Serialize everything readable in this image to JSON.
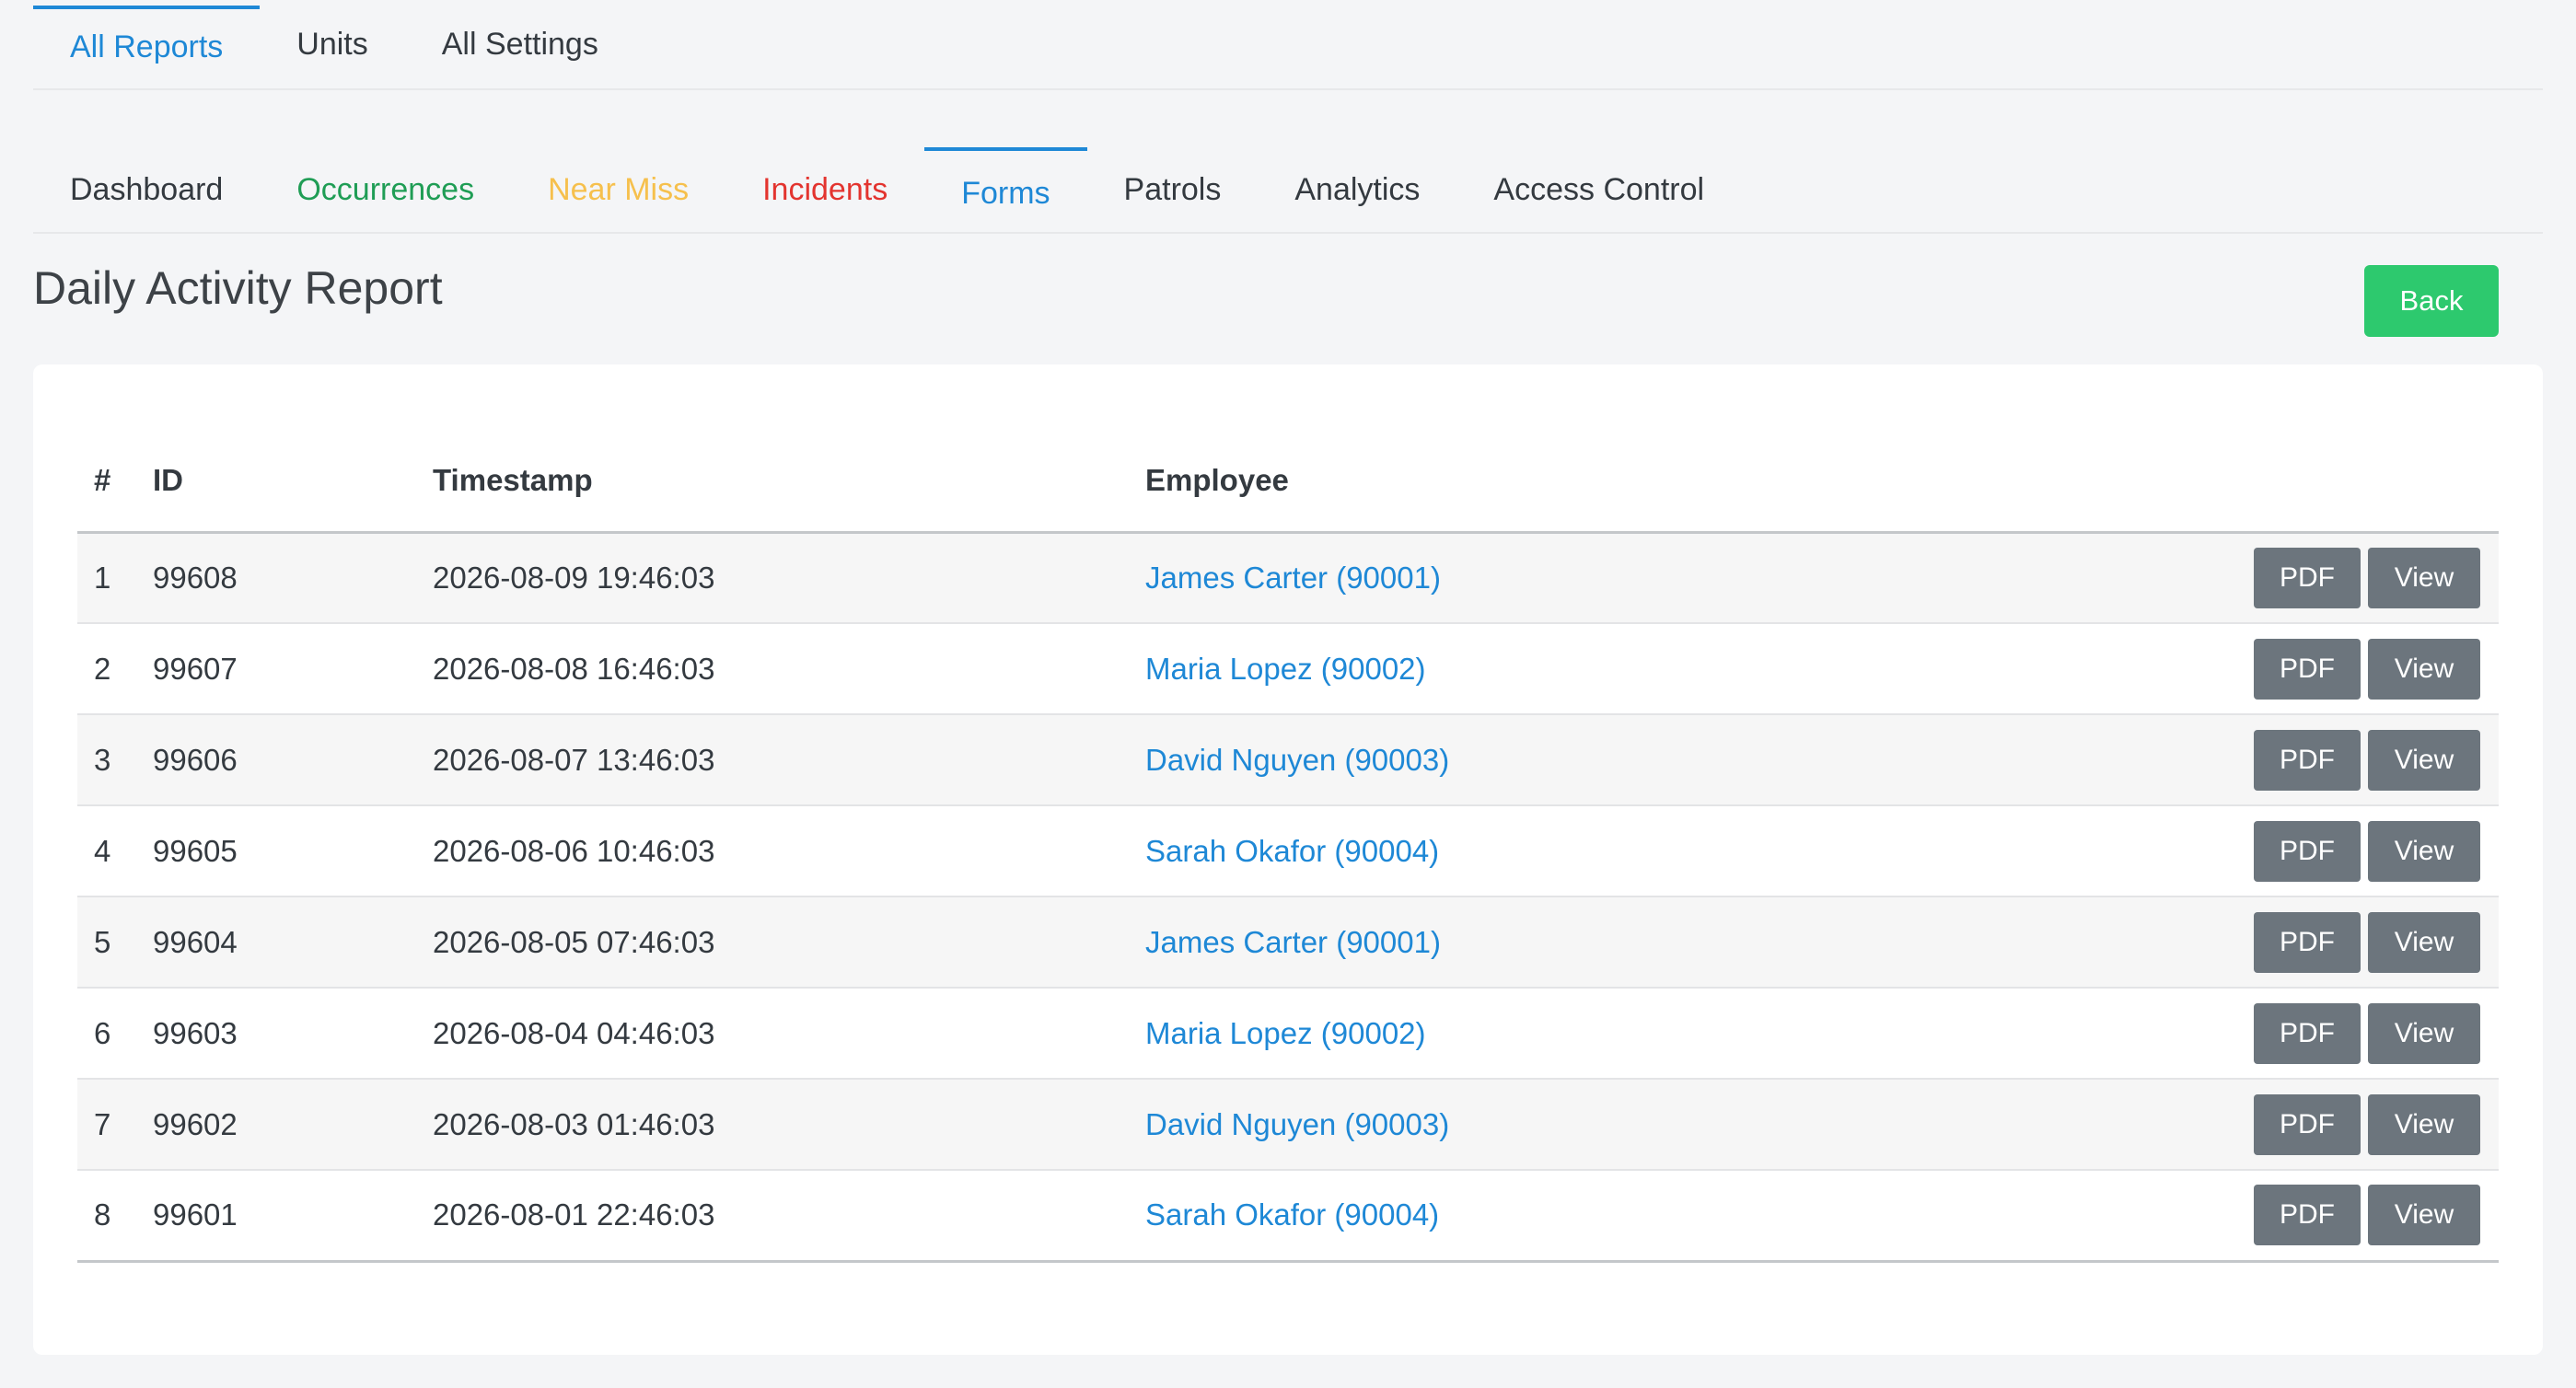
{
  "top_tabs": [
    {
      "label": "All Reports",
      "active": true
    },
    {
      "label": "Units",
      "active": false
    },
    {
      "label": "All Settings",
      "active": false
    }
  ],
  "sub_tabs": [
    {
      "label": "Dashboard",
      "color": "#343a40"
    },
    {
      "label": "Occurrences",
      "color": "#1f9d55"
    },
    {
      "label": "Near Miss",
      "color": "#f6c04d"
    },
    {
      "label": "Incidents",
      "color": "#e3342f"
    },
    {
      "label": "Forms",
      "color": "#1e88d6"
    },
    {
      "label": "Patrols",
      "color": "#343a40"
    },
    {
      "label": "Analytics",
      "color": "#343a40"
    },
    {
      "label": "Access Control",
      "color": "#343a40"
    }
  ],
  "page": {
    "title": "Daily Activity Report",
    "back_label": "Back"
  },
  "table": {
    "headers": {
      "num": "#",
      "id": "ID",
      "timestamp": "Timestamp",
      "employee": "Employee"
    },
    "pdf_label": "PDF",
    "view_label": "View",
    "rows": [
      {
        "num": "1",
        "id": "99608",
        "timestamp": "2026-08-09 19:46:03",
        "employee": "James Carter (90001)"
      },
      {
        "num": "2",
        "id": "99607",
        "timestamp": "2026-08-08 16:46:03",
        "employee": "Maria Lopez (90002)"
      },
      {
        "num": "3",
        "id": "99606",
        "timestamp": "2026-08-07 13:46:03",
        "employee": "David Nguyen (90003)"
      },
      {
        "num": "4",
        "id": "99605",
        "timestamp": "2026-08-06 10:46:03",
        "employee": "Sarah Okafor (90004)"
      },
      {
        "num": "5",
        "id": "99604",
        "timestamp": "2026-08-05 07:46:03",
        "employee": "James Carter (90001)"
      },
      {
        "num": "6",
        "id": "99603",
        "timestamp": "2026-08-04 04:46:03",
        "employee": "Maria Lopez (90002)"
      },
      {
        "num": "7",
        "id": "99602",
        "timestamp": "2026-08-03 01:46:03",
        "employee": "David Nguyen (90003)"
      },
      {
        "num": "8",
        "id": "99601",
        "timestamp": "2026-08-01 22:46:03",
        "employee": "Sarah Okafor (90004)"
      }
    ]
  }
}
